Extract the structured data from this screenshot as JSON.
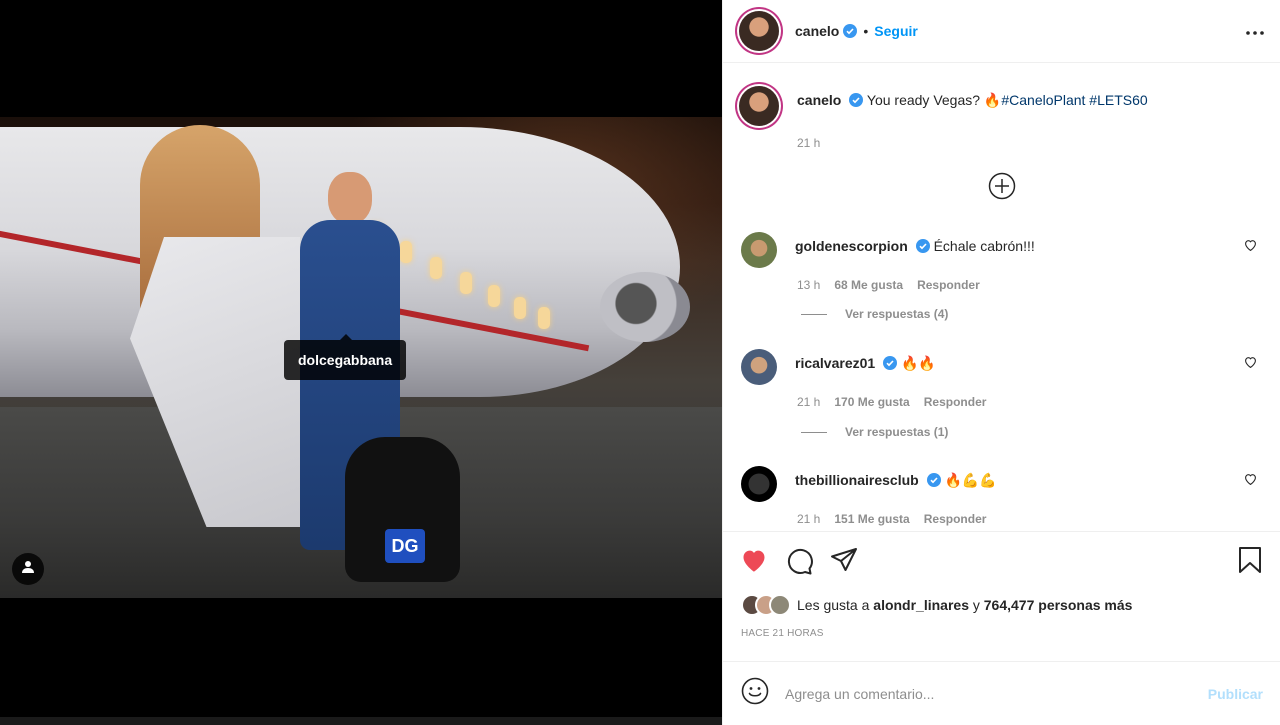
{
  "post": {
    "photo_tag": "dolcegabbana",
    "backpack_logo": "DG"
  },
  "header": {
    "username": "canelo",
    "dot": "•",
    "follow_label": "Seguir"
  },
  "caption": {
    "username": "canelo",
    "text": "You ready Vegas?",
    "emoji": "🔥",
    "hashtags": "#CaneloPlant #LETS60",
    "time": "21 h"
  },
  "comments": [
    {
      "username": "goldenescorpion",
      "text": "Échale cabrón!!!",
      "time": "13 h",
      "likes": "68 Me gusta",
      "reply": "Responder",
      "view_replies": "Ver respuestas (4)"
    },
    {
      "username": "ricalvarez01",
      "text": "🔥🔥",
      "time": "21 h",
      "likes": "170 Me gusta",
      "reply": "Responder",
      "view_replies": "Ver respuestas (1)"
    },
    {
      "username": "thebillionairesclub",
      "text": "🔥💪💪",
      "time": "21 h",
      "likes": "151 Me gusta",
      "reply": "Responder"
    }
  ],
  "likes": {
    "prefix": "Les gusta a",
    "user": "alondr_linares",
    "conj": "y",
    "rest": "764,477 personas más"
  },
  "time_ago": "HACE 21 HORAS",
  "add_comment": {
    "placeholder": "Agrega un comentario...",
    "publish": "Publicar"
  },
  "colors": {
    "accent": "#0095f6",
    "like_red": "#ed4956",
    "hashtag": "#00376b"
  }
}
